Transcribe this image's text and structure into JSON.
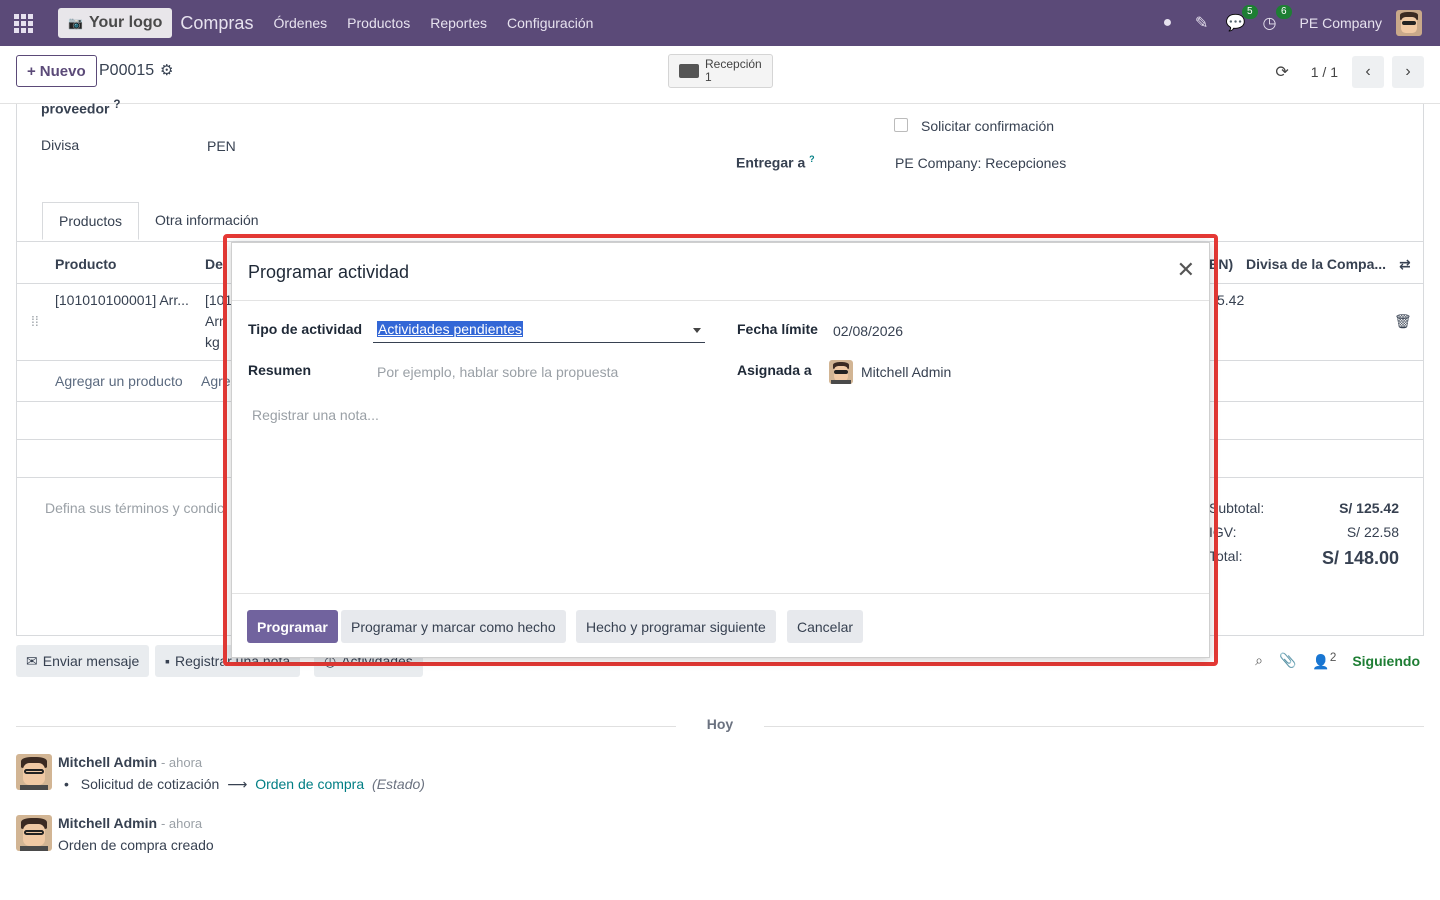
{
  "navbar": {
    "logo_text": "Your logo",
    "app_name": "Compras",
    "menu": [
      "Órdenes",
      "Productos",
      "Reportes",
      "Configuración"
    ],
    "messages_badge": "5",
    "activities_badge": "6",
    "company": "PE Company"
  },
  "control_panel": {
    "new_label": "Nuevo",
    "record_name": "P00015",
    "reception_label": "Recepción",
    "reception_count": "1",
    "pager": "1 / 1"
  },
  "form": {
    "vendor_label_fragment": "proveedor",
    "currency_label": "Divisa",
    "currency_value": "PEN",
    "ask_confirmation_label": "Solicitar confirmación",
    "deliver_to_label": "Entregar a",
    "deliver_to_help": "?",
    "deliver_to_value": "PE Company: Recepciones",
    "tabs": [
      "Productos",
      "Otra información"
    ],
    "columns": {
      "product": "Producto",
      "description_fragment": "De",
      "price_fragment": "EN)",
      "company_currency": "Divisa de la Compa..."
    },
    "line": {
      "product": "[101010100001] Arr...",
      "desc_line1": "[101",
      "desc_line2": "Arr",
      "desc_line3": "kg",
      "amount_fragment": "5.42"
    },
    "add_product": "Agregar un producto",
    "add_fragment": "Agre",
    "terms_placeholder": "Defina sus términos y condic",
    "totals": {
      "subtotal_label": "Subtotal:",
      "subtotal_value": "S/ 125.42",
      "tax_label": "IGV:",
      "tax_value": "S/ 22.58",
      "total_label": "Total:",
      "total_value": "S/ 148.00"
    }
  },
  "chatter": {
    "send_message": "Enviar mensaje",
    "log_note": "Registrar una nota",
    "activities": "Actividades",
    "followers_count": "2",
    "following": "Siguiendo",
    "today": "Hoy",
    "messages": [
      {
        "author": "Mitchell Admin",
        "time": "- ahora",
        "old_value": "Solicitud de cotización",
        "new_value": "Orden de compra",
        "field": "(Estado)"
      },
      {
        "author": "Mitchell Admin",
        "time": "- ahora",
        "body": "Orden de compra creado"
      }
    ]
  },
  "dialog": {
    "title": "Programar actividad",
    "activity_type_label": "Tipo de actividad",
    "activity_type_value": "Actividades pendientes",
    "summary_label": "Resumen",
    "summary_placeholder": "Por ejemplo, hablar sobre la propuesta",
    "deadline_label": "Fecha límite",
    "deadline_value": "02/08/2026",
    "assigned_label": "Asignada a",
    "assigned_value": "Mitchell Admin",
    "note_placeholder": "Registrar una nota...",
    "buttons": {
      "schedule": "Programar",
      "schedule_done": "Programar y marcar como hecho",
      "done_next": "Hecho y programar siguiente",
      "cancel": "Cancelar"
    }
  },
  "colors": {
    "navbar": "#5b4a78",
    "primary_button": "#71639e",
    "highlight_border": "#e53935",
    "following": "#1e7e34",
    "link": "#017e84"
  }
}
